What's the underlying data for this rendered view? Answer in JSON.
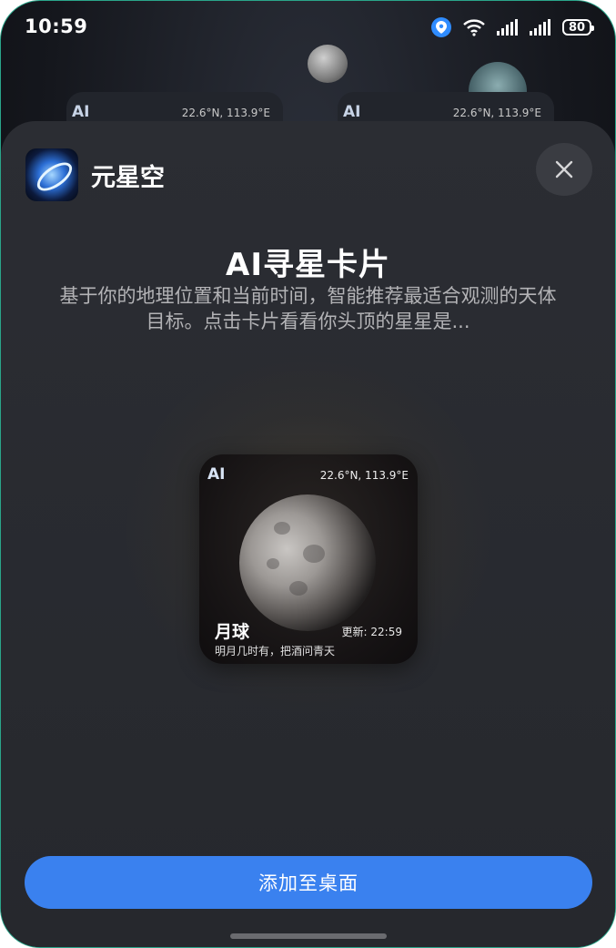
{
  "status_bar": {
    "time": "10:59",
    "battery": "80",
    "icons": [
      "location-icon",
      "wifi-icon",
      "signal-icon",
      "signal-icon",
      "battery-icon"
    ]
  },
  "background_widgets": {
    "ai_label": "AI",
    "left_coord": "22.6°N, 113.9°E",
    "right_coord": "22.6°N, 113.9°E"
  },
  "sheet": {
    "app_name": "元星空",
    "title": "AI寻星卡片",
    "description": "基于你的地理位置和当前时间，智能推荐最适合观测的天体目标。点击卡片看看你头顶的星星是...",
    "close_icon": "close-icon"
  },
  "preview_card": {
    "ai_badge": "AI",
    "coord": "22.6°N, 113.9°E",
    "object": "月球",
    "update": "更新: 22:59",
    "quote": "明月几时有，把酒问青天"
  },
  "actions": {
    "add_label": "添加至桌面"
  },
  "colors": {
    "accent": "#3a81ef",
    "sheet": "#2b2d33"
  }
}
